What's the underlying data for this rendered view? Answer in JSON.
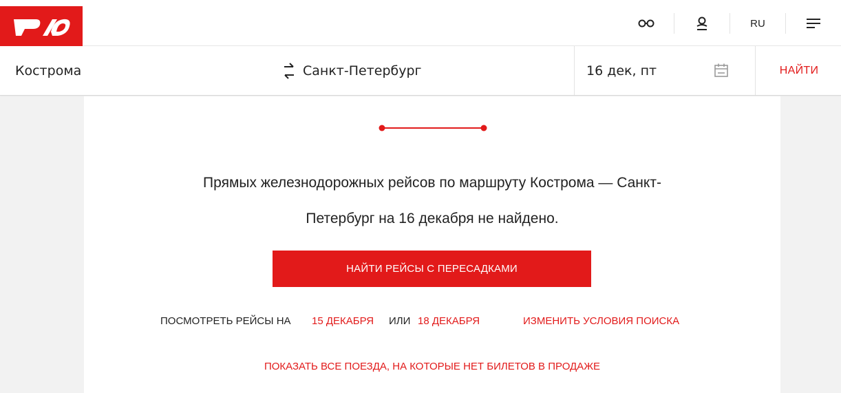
{
  "brand": {
    "logo_text": "РЖД",
    "color": "#e21a1a"
  },
  "header": {
    "language": "RU",
    "icons": [
      "glasses-icon",
      "user-icon",
      "menu-icon"
    ]
  },
  "search": {
    "from": "Кострома",
    "to": "Санкт-Петербург",
    "date": "16 дек, пт",
    "find_label": "НАЙТИ"
  },
  "result": {
    "message_line1": "Прямых железнодорожных рейсов по маршруту Кострома — Санкт-",
    "message_line2": "Петербург на 16 декабря не найдено.",
    "transfers_button": "НАЙТИ РЕЙСЫ С ПЕРЕСАДКАМИ",
    "see_trains_prefix": "ПОСМОТРЕТЬ РЕЙСЫ НА",
    "date_prev": "15 ДЕКАБРЯ",
    "or_label": "ИЛИ",
    "date_next": "18 ДЕКАБРЯ",
    "change_conditions": "ИЗМЕНИТЬ УСЛОВИЯ ПОИСКА",
    "show_all_trains": "ПОКАЗАТЬ ВСЕ ПОЕЗДА, НА КОТОРЫЕ НЕТ БИЛЕТОВ В ПРОДАЖЕ"
  }
}
